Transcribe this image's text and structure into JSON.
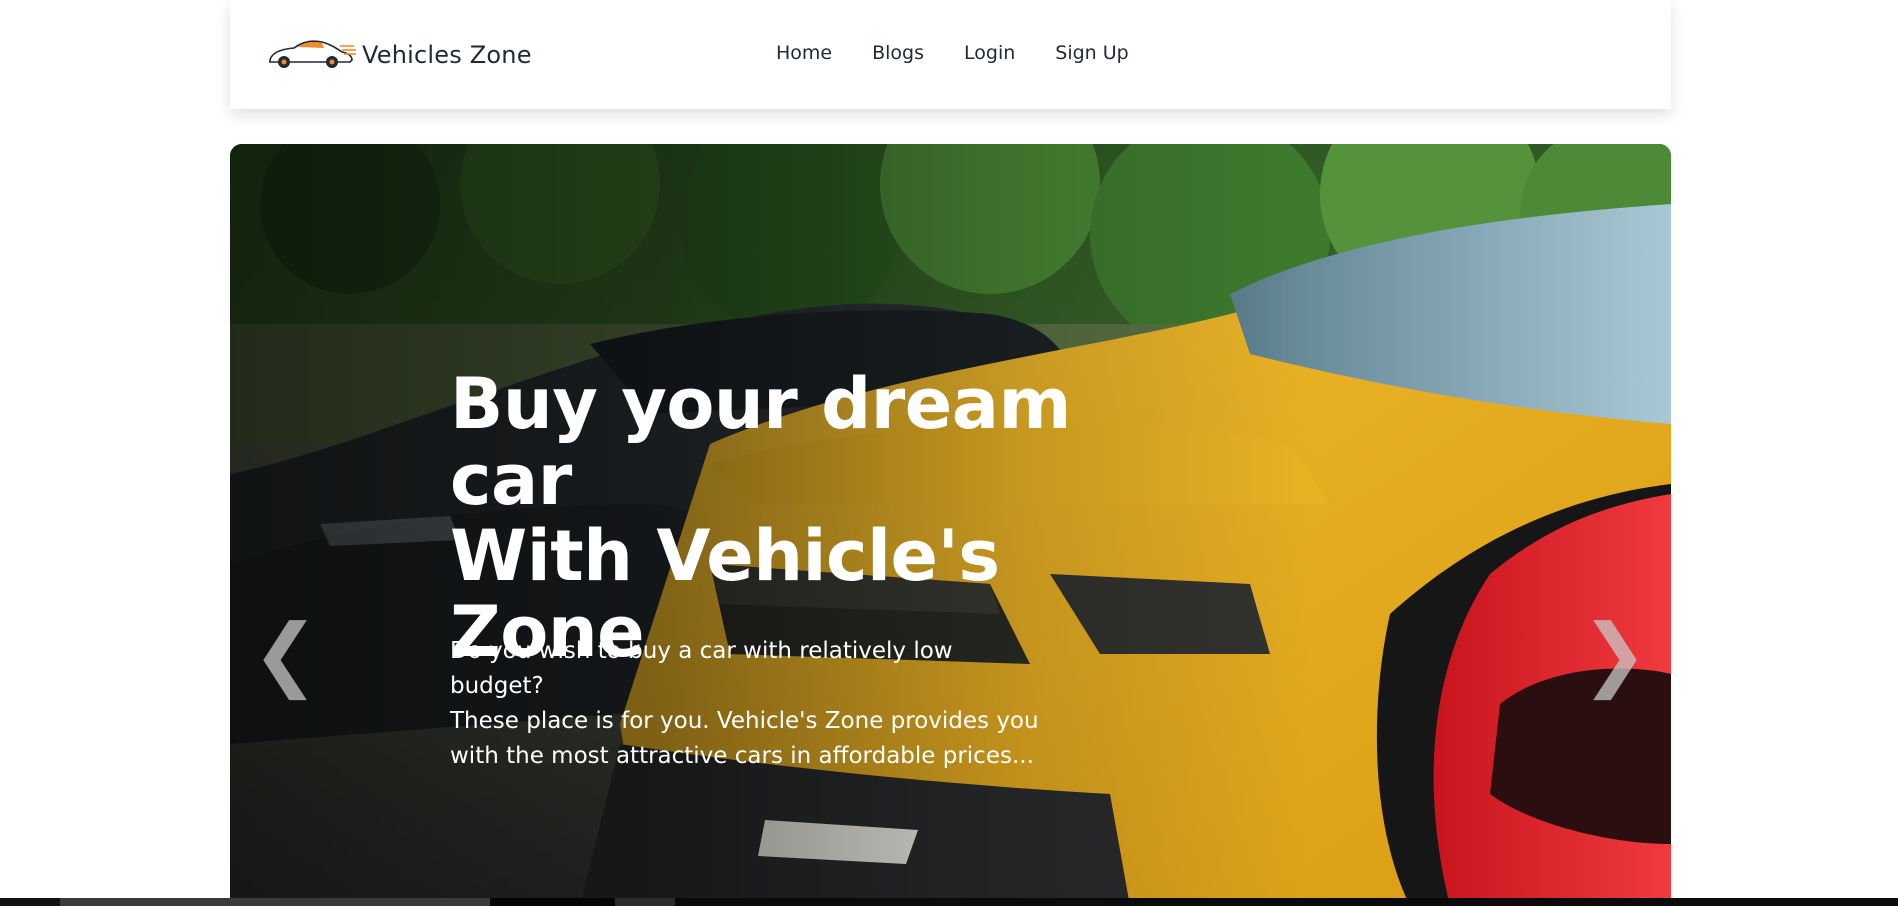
{
  "navbar": {
    "brand_name": "Vehicles Zone",
    "links": [
      "Home",
      "Blogs",
      "Login",
      "Sign Up"
    ]
  },
  "hero": {
    "title_lines": [
      "Buy your dream car",
      "With Vehicle's",
      "Zone"
    ],
    "subtitle_lines": [
      "Do you wish to buy a car with relatively low budget?",
      "These place is for you. Vehicle's Zone provides you",
      "with the most attractive cars in affordable prices..."
    ],
    "prev_arrow": "❮",
    "next_arrow": "❯"
  },
  "colors": {
    "accent": "#f28c28",
    "text": "#1f2937",
    "car_yellow": "#e9ae1c",
    "car_red": "#e3262e"
  }
}
